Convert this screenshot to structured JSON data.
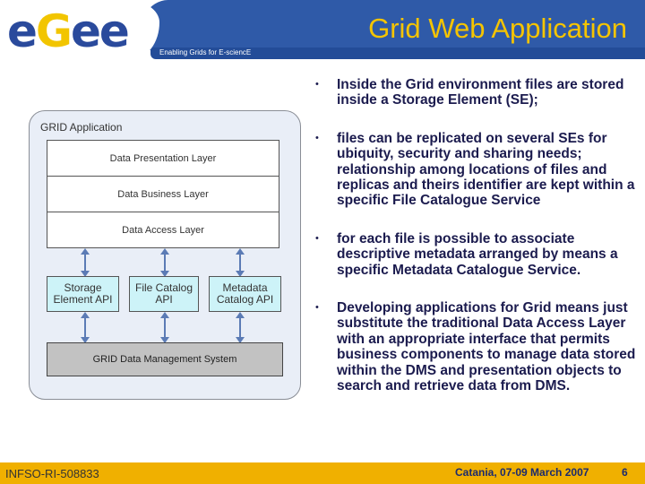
{
  "header": {
    "logo": "egee",
    "tagline": "Enabling Grids for E-sciencE",
    "title": "Grid Web Application"
  },
  "diagram": {
    "container_label": "GRID Application",
    "layers": [
      "Data Presentation Layer",
      "Data Business Layer",
      "Data Access Layer"
    ],
    "apis": [
      {
        "l1": "Storage",
        "l2": "Element API"
      },
      {
        "l1": "File Catalog",
        "l2": "API"
      },
      {
        "l1": "Metadata",
        "l2": "Catalog API"
      }
    ],
    "dms": "GRID Data Management System"
  },
  "bullets": [
    "Inside the Grid environment files are stored inside a Storage Element (SE);",
    "files can be replicated on several SEs for ubiquity, security and sharing needs; relationship among locations of files and replicas and theirs identifier are kept within a specific File Catalogue Service",
    "for each file is possible to associate descriptive metadata arranged by means a specific Metadata Catalogue Service.",
    "Developing applications for Grid means just substitute the traditional Data Access Layer with an appropriate interface that permits business components to manage data stored within the DMS and presentation objects to search and retrieve data from DMS."
  ],
  "bullet_symbol": "•",
  "footer": {
    "project": "INFSO-RI-508833",
    "event": "Catania, 07-09 March 2007",
    "page": "6"
  }
}
